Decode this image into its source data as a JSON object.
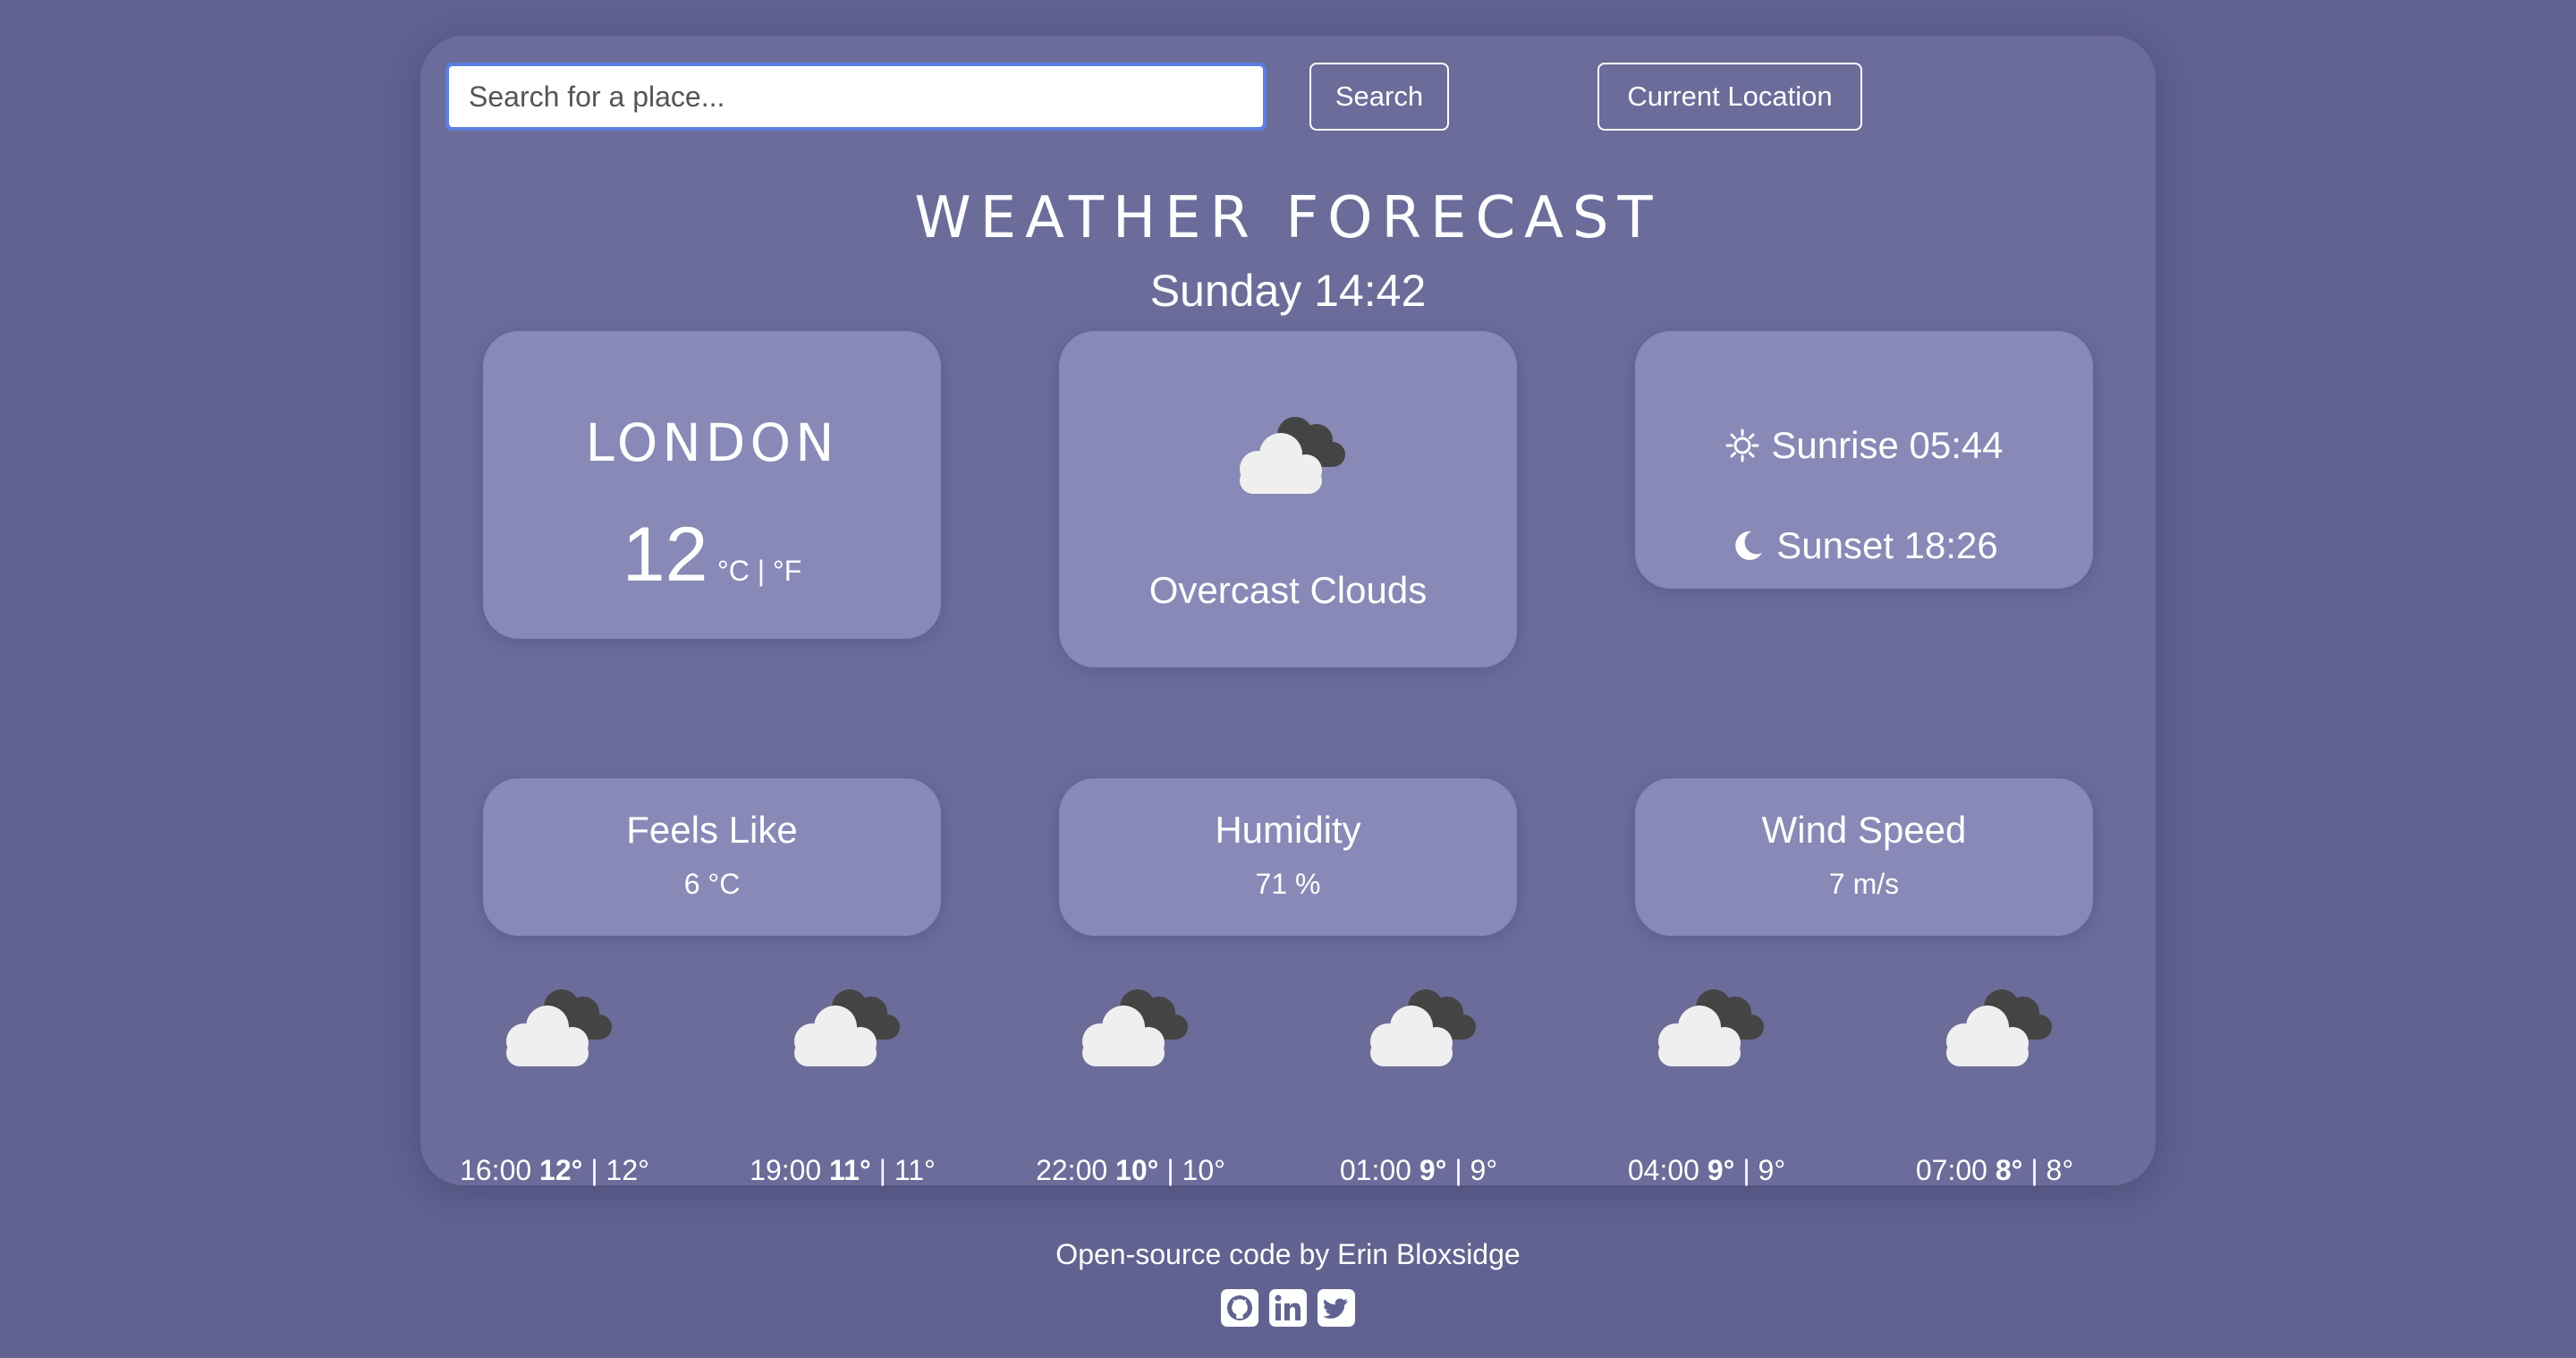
{
  "search": {
    "placeholder": "Search for a place...",
    "value": ""
  },
  "buttons": {
    "search_label": "Search",
    "location_label": "Current Location"
  },
  "header": {
    "title": "WEATHER FORECAST",
    "datetime": "Sunday 14:42"
  },
  "current": {
    "city": "LONDON",
    "temperature": "12",
    "units": "°C | °F",
    "condition": "Overcast Clouds",
    "condition_icon": "overcast-cloud-icon",
    "sunrise": "Sunrise 05:44",
    "sunset": "Sunset 18:26"
  },
  "stats": {
    "feels_like": {
      "label": "Feels Like",
      "value": "6 °C"
    },
    "humidity": {
      "label": "Humidity",
      "value": "71 %"
    },
    "wind": {
      "label": "Wind Speed",
      "value": "7 m/s"
    }
  },
  "forecast": [
    {
      "time": "16:00",
      "high": "12°",
      "low": "12°"
    },
    {
      "time": "19:00",
      "high": "11°",
      "low": "11°"
    },
    {
      "time": "22:00",
      "high": "10°",
      "low": "10°"
    },
    {
      "time": "01:00",
      "high": "9°",
      "low": "9°"
    },
    {
      "time": "04:00",
      "high": "9°",
      "low": "9°"
    },
    {
      "time": "07:00",
      "high": "8°",
      "low": "8°"
    }
  ],
  "footer": {
    "credit": "Open-source code by Erin Bloxsidge",
    "social_icons": [
      "github-icon",
      "linkedin-icon",
      "twitter-icon"
    ]
  },
  "colors": {
    "background": "#626290",
    "card": "#6b6c99",
    "panel": "#8889b6",
    "input_border": "#5b7fe0"
  }
}
